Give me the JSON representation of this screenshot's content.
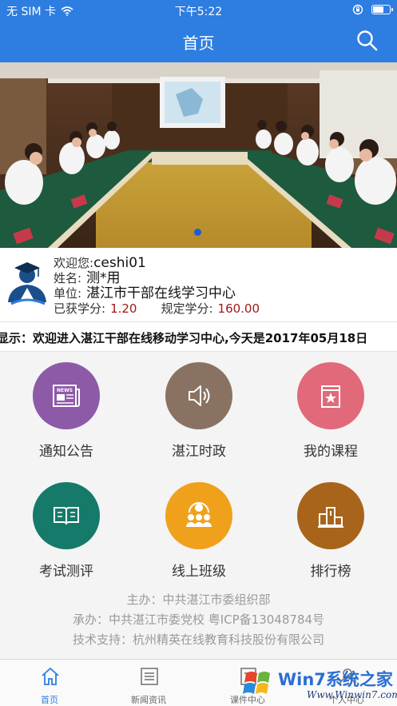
{
  "status_bar": {
    "carrier": "无 SIM 卡",
    "time": "下午5:22"
  },
  "nav": {
    "title": "首页"
  },
  "profile": {
    "welcome_label": "欢迎您:",
    "username": "ceshi01",
    "name_label": "姓名:",
    "name": "测*用",
    "unit_label": "单位:",
    "unit": "湛江市干部在线学习中心",
    "earned_label": "已获学分:",
    "earned": "1.20",
    "required_label": "规定学分:",
    "required": "160.00"
  },
  "marquee": {
    "text": "显示：欢迎进入湛江干部在线移动学习中心,今天是2017年05月18日"
  },
  "menu": [
    {
      "label": "通知公告",
      "icon": "newspaper-icon",
      "color": "#8d5aa8"
    },
    {
      "label": "湛江时政",
      "icon": "speaker-icon",
      "color": "#8a7262"
    },
    {
      "label": "我的课程",
      "icon": "star-book-icon",
      "color": "#e2697a"
    },
    {
      "label": "考试测评",
      "icon": "open-book-icon",
      "color": "#157a6a"
    },
    {
      "label": "线上班级",
      "icon": "group-icon",
      "color": "#f0a11c"
    },
    {
      "label": "排行榜",
      "icon": "podium-icon",
      "color": "#a8641a"
    }
  ],
  "footer": {
    "host": "主办：中共湛江市委组织部",
    "organizer": "承办：中共湛江市委党校 粤ICP备13048784号",
    "support": "技术支持：杭州精英在线教育科技股份有限公司"
  },
  "tabs": [
    {
      "label": "首页",
      "icon": "home-icon"
    },
    {
      "label": "新闻资讯",
      "icon": "news-list-icon"
    },
    {
      "label": "课件中心",
      "icon": "courseware-icon"
    },
    {
      "label": "个人中心",
      "icon": "person-icon"
    }
  ],
  "watermark": {
    "title": "Win7系统之家",
    "url": "Www.Winwin7.com"
  },
  "colors": {
    "primary": "#2e7de1",
    "credit": "#a01818"
  }
}
